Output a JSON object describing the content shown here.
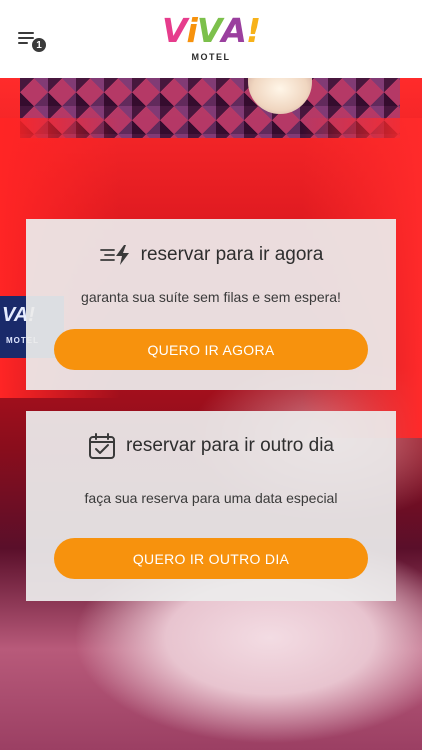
{
  "header": {
    "menu_badge": "1",
    "logo": {
      "word": [
        "V",
        "i",
        "V",
        "A",
        "!"
      ],
      "colors": [
        "#e63c8c",
        "#f7920d",
        "#7cc04b",
        "#9a3f9e",
        "#f7b21a"
      ],
      "sub": "MOTEL"
    }
  },
  "background": {
    "tv_logo_text": "VA!",
    "tv_sub": "MOTEL"
  },
  "cards": [
    {
      "icon": "lightning-speed-icon",
      "title": "reservar para ir agora",
      "subtitle": "garanta sua suíte sem filas e sem espera!",
      "button": "QUERO IR AGORA"
    },
    {
      "icon": "calendar-check-icon",
      "title": "reservar para ir outro dia",
      "subtitle": "faça sua reserva para uma data especial",
      "button": "QUERO IR OUTRO DIA"
    }
  ],
  "colors": {
    "accent": "#f7920d",
    "header_bg": "#ffffff",
    "card_bg": "#ececec"
  }
}
